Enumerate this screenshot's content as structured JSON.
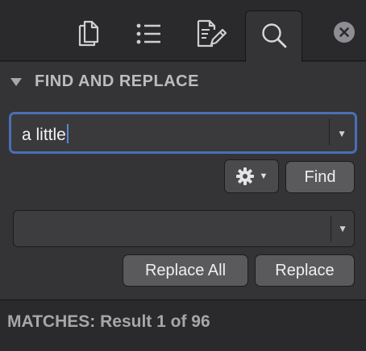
{
  "toolbar": {
    "tabs": [
      {
        "name": "documents",
        "icon": "documents-icon"
      },
      {
        "name": "list",
        "icon": "list-icon"
      },
      {
        "name": "edit",
        "icon": "edit-document-icon"
      },
      {
        "name": "search",
        "icon": "search-icon",
        "active": true
      }
    ],
    "close_icon": "close-icon"
  },
  "find_replace": {
    "title": "FIND AND REPLACE",
    "collapse_icon": "disclosure-triangle-icon",
    "find_value": "a little",
    "options_icon": "gear-icon",
    "find_button": "Find",
    "replace_value": "",
    "replace_all_button": "Replace All",
    "replace_button": "Replace"
  },
  "status": {
    "matches": "MATCHES: Result 1 of 96"
  },
  "colors": {
    "background": "#2b2b2d",
    "panel": "#343436",
    "focus_ring": "#4a6fb5",
    "button": "#5a5a5c"
  }
}
